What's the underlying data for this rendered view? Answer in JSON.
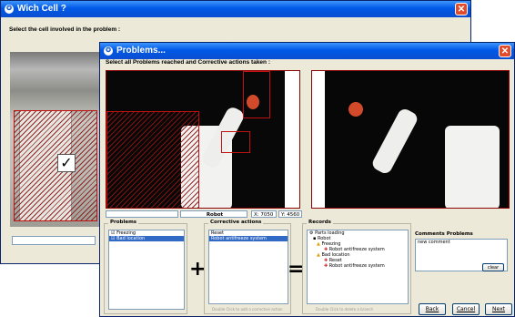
{
  "back_window": {
    "title": "Wich Cell ?",
    "prompt": "Select the cell involved in the problem :"
  },
  "problems_window": {
    "title": "Problems...",
    "prompt": "Select all Problems reached and Corrective actions taken :",
    "image_label": "Robot",
    "x_readout": "X: 7050",
    "y_readout": "Y: 4560",
    "problems": {
      "label": "Problems",
      "items": [
        {
          "text": "Freezing",
          "checked": true,
          "selected": false
        },
        {
          "text": "Bad location",
          "checked": true,
          "selected": true
        }
      ]
    },
    "actions": {
      "label": "Corrective actions",
      "items": [
        {
          "text": "Reset",
          "selected": false
        },
        {
          "text": "Robot antifreeze system",
          "selected": true
        }
      ],
      "hint": "Double Click to add a corrective action"
    },
    "plus_symbol": "+",
    "equals_symbol": "=",
    "records": {
      "label": "Records",
      "root": "Parts loading",
      "child": "Robot",
      "problem1": "Freezing",
      "action1": "Robot antifreeze system",
      "problem2": "Bad location",
      "action2": "Reset",
      "action3": "Robot antifreeze system",
      "hint": "Double Click to delete a branch"
    },
    "comments": {
      "label": "Comments Problems",
      "value": "new comment",
      "clear_label": "clear"
    },
    "buttons": {
      "back": "Back",
      "cancel": "Cancel",
      "next": "Next"
    },
    "colors": {
      "selection": "#316ac5",
      "titlebar": "#0058e6",
      "marker": "#c01010"
    }
  }
}
